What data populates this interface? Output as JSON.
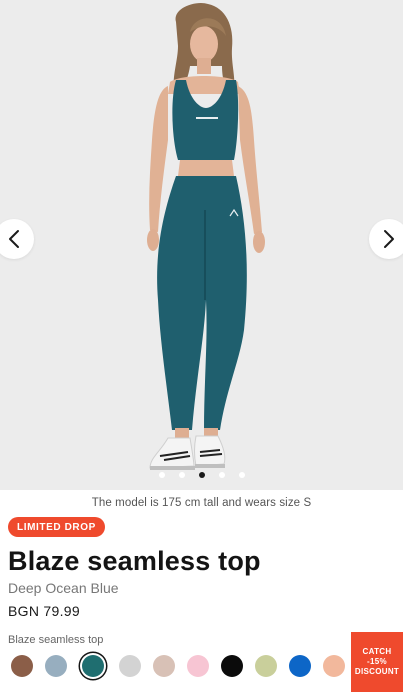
{
  "gallery": {
    "image_alt": "Model wearing deep ocean blue seamless sports bra and leggings",
    "slide_count": 5,
    "active_slide": 3,
    "prev_icon": "chevron-left-icon",
    "next_icon": "chevron-right-icon"
  },
  "caption": "The model is 175 cm tall and wears size S",
  "badge": "LIMITED DROP",
  "product": {
    "title": "Blaze seamless top",
    "color_name": "Deep Ocean Blue",
    "price": "BGN 79.99",
    "variant_label": "Blaze seamless top"
  },
  "swatches": [
    {
      "color": "#8b5e48",
      "selected": false
    },
    {
      "color": "#97aebf",
      "selected": false
    },
    {
      "color": "#1f6e70",
      "selected": true
    },
    {
      "color": "#d3d3d3",
      "selected": false
    },
    {
      "color": "#d8c1b6",
      "selected": false
    },
    {
      "color": "#f7c5d3",
      "selected": false
    },
    {
      "color": "#0b0b0b",
      "selected": false
    },
    {
      "color": "#c9cf9b",
      "selected": false
    },
    {
      "color": "#0d66c7",
      "selected": false
    },
    {
      "color": "#f2b89c",
      "selected": false
    }
  ],
  "promo": {
    "line1": "CATCH",
    "line2": "-15%",
    "line3": "DISCOUNT"
  },
  "colors": {
    "accent": "#ef4a2d",
    "garment": "#1f5f6e",
    "background": "#ececec"
  }
}
